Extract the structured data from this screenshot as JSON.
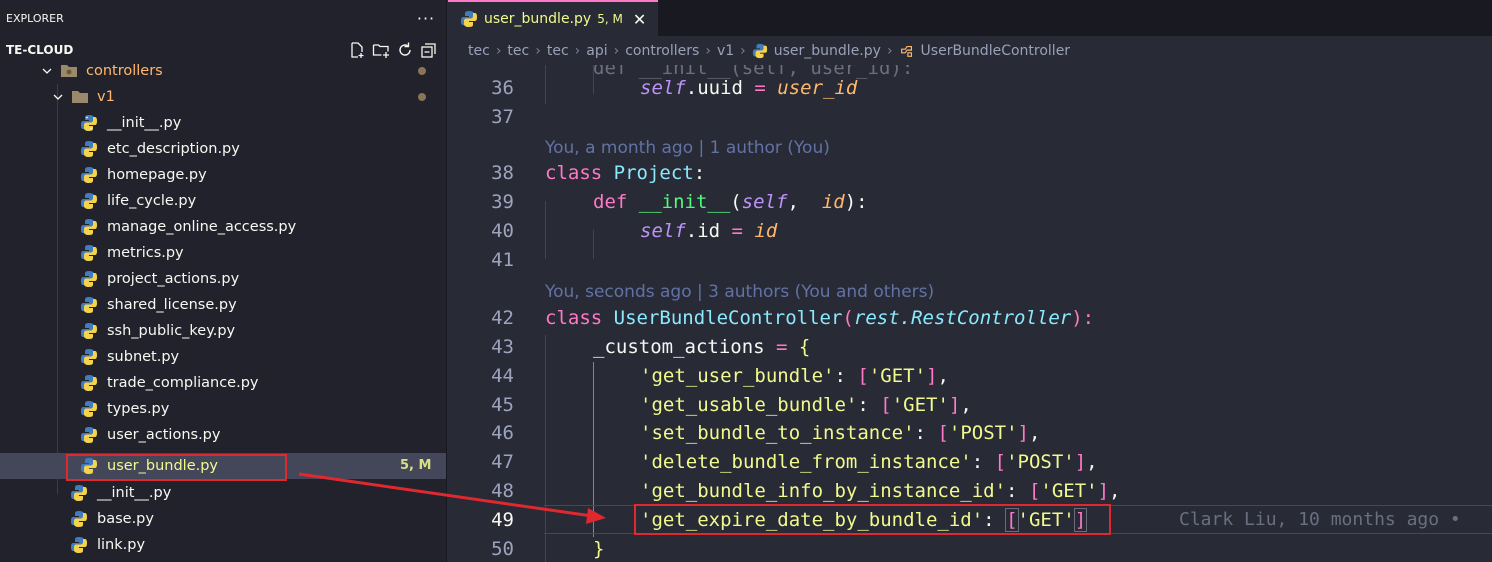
{
  "sidebar": {
    "title": "EXPLORER",
    "more": "···",
    "section": "TE-CLOUD",
    "action_icons": [
      "new-file-icon",
      "new-folder-icon",
      "refresh-icon",
      "collapse-all-icon"
    ],
    "items": [
      {
        "label": "controllers",
        "kind": "folder"
      },
      {
        "label": "v1",
        "kind": "folder"
      },
      {
        "label": "__init__.py"
      },
      {
        "label": "etc_description.py"
      },
      {
        "label": "homepage.py"
      },
      {
        "label": "life_cycle.py"
      },
      {
        "label": "manage_online_access.py"
      },
      {
        "label": "metrics.py"
      },
      {
        "label": "project_actions.py"
      },
      {
        "label": "shared_license.py"
      },
      {
        "label": "ssh_public_key.py"
      },
      {
        "label": "subnet.py"
      },
      {
        "label": "trade_compliance.py"
      },
      {
        "label": "types.py"
      },
      {
        "label": "user_actions.py"
      },
      {
        "label": "user_bundle.py",
        "badge": "5, M"
      },
      {
        "label": "__init__.py"
      },
      {
        "label": "base.py"
      },
      {
        "label": "link.py"
      }
    ]
  },
  "editor": {
    "tab": {
      "label": "user_bundle.py",
      "badge": "5, M",
      "close": "✕"
    },
    "breadcrumb": [
      "tec",
      "tec",
      "tec",
      "api",
      "controllers",
      "v1",
      "user_bundle.py",
      "UserBundleController"
    ],
    "line_numbers": [
      "36",
      "37",
      "38",
      "39",
      "40",
      "41",
      "42",
      "43",
      "44",
      "45",
      "46",
      "47",
      "48",
      "49",
      "50"
    ],
    "codelens": [
      "You, a month ago | 1 author (You)",
      "You, seconds ago | 3 authors (You and others)"
    ],
    "blame": "Clark Liu, 10 months ago •",
    "code": {
      "l36": {
        "self": "self",
        "attr": ".uuid ",
        "eq": "=",
        "param": " user_id"
      },
      "l38": {
        "kw": "class",
        "name": " Project",
        "colon": ":"
      },
      "l39": {
        "kw": "def",
        "fn": " __init__",
        "open": "(",
        "self": "self",
        "comma": ",  ",
        "param": "id",
        "close": "):"
      },
      "l40": {
        "self": "self",
        "attr": ".id ",
        "eq": "=",
        "param": " id"
      },
      "l42": {
        "kw": "class",
        "name": " UserBundleController",
        "open": "(",
        "base": "rest.RestController",
        "close": "):"
      },
      "l43": {
        "name": "_custom_actions ",
        "eq": "=",
        "brace": " {"
      },
      "entries": [
        {
          "key": "'get_user_bundle'",
          "method": "'GET'"
        },
        {
          "key": "'get_usable_bundle'",
          "method": "'GET'"
        },
        {
          "key": "'set_bundle_to_instance'",
          "method": "'POST'"
        },
        {
          "key": "'delete_bundle_from_instance'",
          "method": "'POST'"
        },
        {
          "key": "'get_bundle_info_by_instance_id'",
          "method": "'GET'"
        },
        {
          "key": "'get_expire_date_by_bundle_id'",
          "method": "'GET'"
        }
      ],
      "l50": "}"
    }
  },
  "colors": {
    "annotation": "#e0282f",
    "accent": "#ff79c6"
  }
}
